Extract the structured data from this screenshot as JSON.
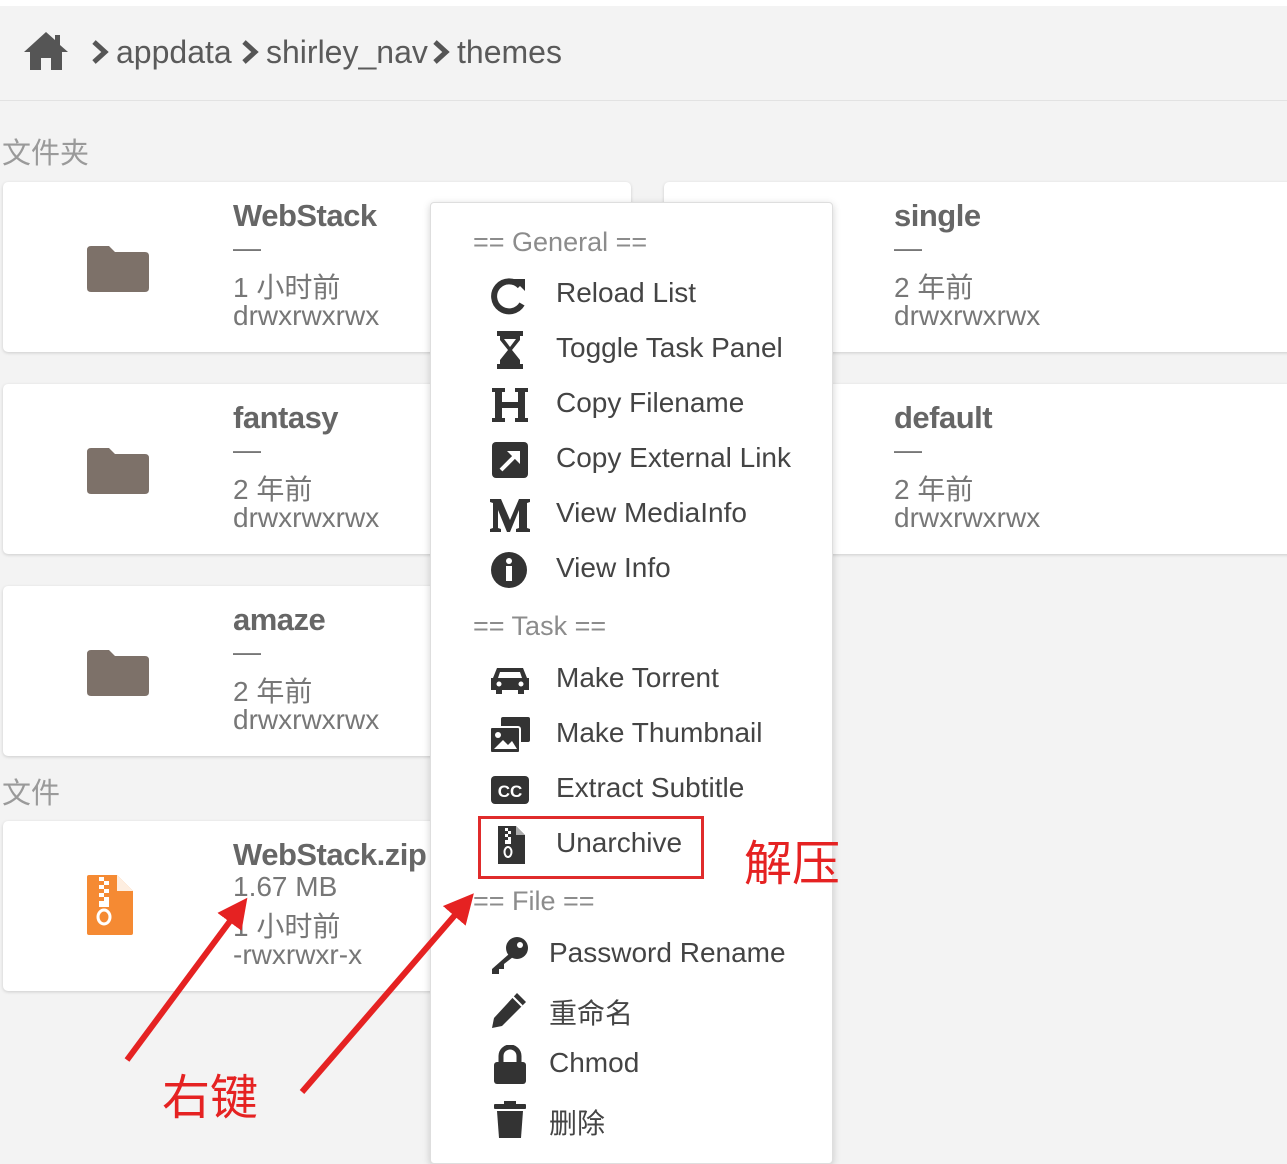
{
  "breadcrumb": {
    "home_icon": "home-icon",
    "items": [
      "appdata",
      "shirley_nav",
      "themes"
    ]
  },
  "sections": {
    "folders": "文件夹",
    "files": "文件"
  },
  "folders": [
    {
      "name": "WebStack",
      "size": "—",
      "time": "1 小时前",
      "perm": "drwxrwxrwx"
    },
    {
      "name": "single",
      "size": "—",
      "time": "2 年前",
      "perm": "drwxrwxrwx"
    },
    {
      "name": "fantasy",
      "size": "—",
      "time": "2 年前",
      "perm": "drwxrwxrwx"
    },
    {
      "name": "default",
      "size": "—",
      "time": "2 年前",
      "perm": "drwxrwxrwx"
    },
    {
      "name": "amaze",
      "size": "—",
      "time": "2 年前",
      "perm": "drwxrwxrwx"
    }
  ],
  "files": [
    {
      "name": "WebStack.zip",
      "size": "1.67 MB",
      "time": "1 小时前",
      "perm": "-rwxrwxr-x"
    }
  ],
  "context_menu": {
    "general_header": "== General ==",
    "general": [
      {
        "icon": "reload-icon",
        "label": "Reload List"
      },
      {
        "icon": "hourglass-icon",
        "label": "Toggle Task Panel"
      },
      {
        "icon": "heading-icon",
        "label": "Copy Filename"
      },
      {
        "icon": "external-link-icon",
        "label": "Copy External Link"
      },
      {
        "icon": "medium-icon",
        "label": "View MediaInfo"
      },
      {
        "icon": "info-icon",
        "label": "View Info"
      }
    ],
    "task_header": "== Task ==",
    "task": [
      {
        "icon": "car-icon",
        "label": "Make Torrent"
      },
      {
        "icon": "images-icon",
        "label": "Make Thumbnail"
      },
      {
        "icon": "closed-captioning-icon",
        "label": "Extract Subtitle"
      },
      {
        "icon": "file-archive-icon",
        "label": "Unarchive"
      }
    ],
    "file_header": "== File ==",
    "file": [
      {
        "icon": "key-icon",
        "label": "Password Rename"
      },
      {
        "icon": "pencil-icon",
        "label": "重命名"
      },
      {
        "icon": "lock-icon",
        "label": "Chmod"
      },
      {
        "icon": "trash-icon",
        "label": "删除"
      }
    ]
  },
  "annotations": {
    "unarchive_note": "解压",
    "right_click_note": "右键",
    "color": "#e52222"
  },
  "colors": {
    "folder": "#7d7169",
    "zip": "#f58a33",
    "background": "#f3f3f3"
  }
}
